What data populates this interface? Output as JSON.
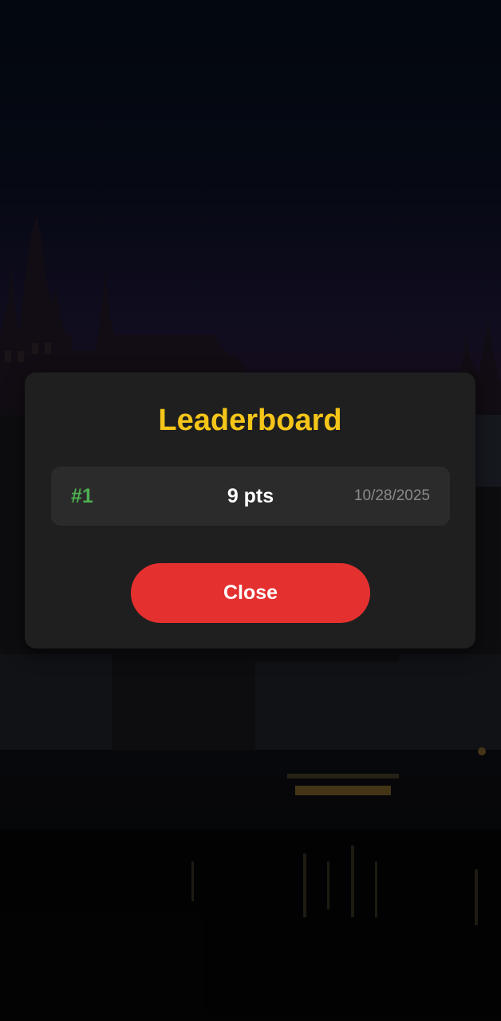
{
  "leaderboard": {
    "title": "Leaderboard",
    "entries": [
      {
        "rank": "#1",
        "points": "9 pts",
        "date": "10/28/2025"
      }
    ],
    "close_label": "Close"
  },
  "colors": {
    "title": "#f5c518",
    "rank": "#4caf50",
    "close_button": "#e53030",
    "dialog_bg": "#1f1f1f",
    "row_bg": "#2b2b2b"
  }
}
